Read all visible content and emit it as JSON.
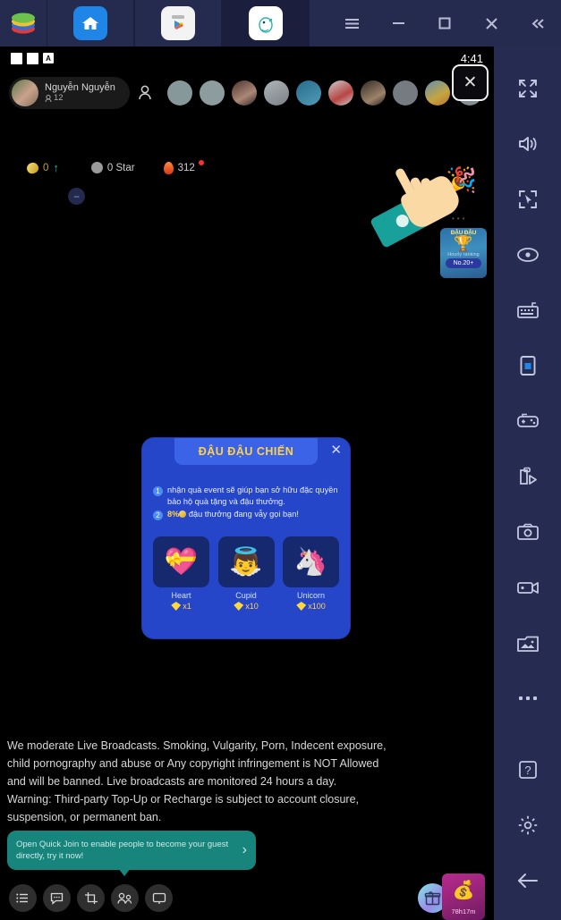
{
  "emulator": {
    "tabs": [
      {
        "name": "bluestacks-logo",
        "icon": "bluestacks-logo-icon"
      },
      {
        "name": "home",
        "icon": "home-icon",
        "active": false
      },
      {
        "name": "play-store",
        "icon": "google-play-icon",
        "active": false
      },
      {
        "name": "bigo-live",
        "icon": "bigo-live-icon",
        "active": true
      }
    ],
    "window_controls": [
      {
        "name": "menu",
        "glyph": "☰"
      },
      {
        "name": "minimize",
        "glyph": "−"
      },
      {
        "name": "maximize",
        "glyph": "□"
      },
      {
        "name": "close",
        "glyph": "✕"
      },
      {
        "name": "collapse",
        "glyph": "«"
      }
    ]
  },
  "status_bar": {
    "time": "4:41",
    "indicator_letter": "A"
  },
  "stream": {
    "user": {
      "name": "Nguyễn Nguyễn",
      "viewers": "12"
    },
    "close_button": "✕",
    "stats": {
      "coin_value": "0",
      "star_label": "0 Star",
      "flame_value": "312"
    },
    "minus_button": "−",
    "rank_card": {
      "title": "ĐẬU ĐẬU",
      "subtitle": "Hourly ranking",
      "badge": "No.20+"
    }
  },
  "modal": {
    "title": "ĐẬU ĐẬU CHIẾN",
    "close": "✕",
    "bullets": [
      {
        "num": "1",
        "text": "nhận quà event sẽ giúp bạn sở hữu đặc quyền bảo hộ quà tặng và đậu thưởng."
      },
      {
        "num": "2",
        "prefix": "8%",
        "text": "đậu thưởng đang vẫy gọi bạn!"
      }
    ],
    "gifts": [
      {
        "name": "Heart",
        "qty": "x1",
        "emoji": "💝"
      },
      {
        "name": "Cupid",
        "qty": "x10",
        "emoji": "👼"
      },
      {
        "name": "Unicorn",
        "qty": "x100",
        "emoji": "🦄"
      }
    ]
  },
  "moderation": {
    "line1": "We moderate Live Broadcasts. Smoking, Vulgarity, Porn, Indecent exposure,",
    "line2": "child pornography and abuse or Any copyright infringement is NOT Allowed",
    "line3": "and will be banned. Live broadcasts are monitored 24 hours a day.",
    "line4": "Warning: Third-party Top-Up or Recharge is subject to account closure,",
    "line5": "suspension, or permanent ban."
  },
  "quick_join": {
    "text": "Open Quick Join to enable people to become your guest directly, try it now!",
    "arrow": "›"
  },
  "bottom_nav": {
    "items": [
      {
        "name": "list-icon"
      },
      {
        "name": "chat-icon"
      },
      {
        "name": "frame-icon"
      },
      {
        "name": "guests-icon"
      },
      {
        "name": "screen-share-icon"
      }
    ],
    "gift_button": "gift-icon",
    "coin_button": "coin-icon",
    "bank_badge": {
      "timer": "78h17m"
    }
  },
  "sidebar": {
    "items": [
      {
        "name": "fullscreen-icon"
      },
      {
        "name": "volume-icon"
      },
      {
        "name": "cursor-target-icon"
      },
      {
        "name": "eye-icon"
      },
      {
        "name": "keyboard-icon"
      },
      {
        "name": "phone-screen-icon"
      },
      {
        "name": "gamepad-icon"
      },
      {
        "name": "macro-script-icon"
      },
      {
        "name": "camera-icon"
      },
      {
        "name": "video-record-icon"
      },
      {
        "name": "media-gallery-icon"
      },
      {
        "name": "more-icon"
      },
      {
        "name": "help-icon"
      },
      {
        "name": "settings-icon"
      },
      {
        "name": "back-icon"
      }
    ]
  },
  "colors": {
    "emulator_bg": "#252a4f",
    "modal_blue": "#2546c9",
    "gold": "#ffd24a",
    "teal": "#17857c"
  }
}
